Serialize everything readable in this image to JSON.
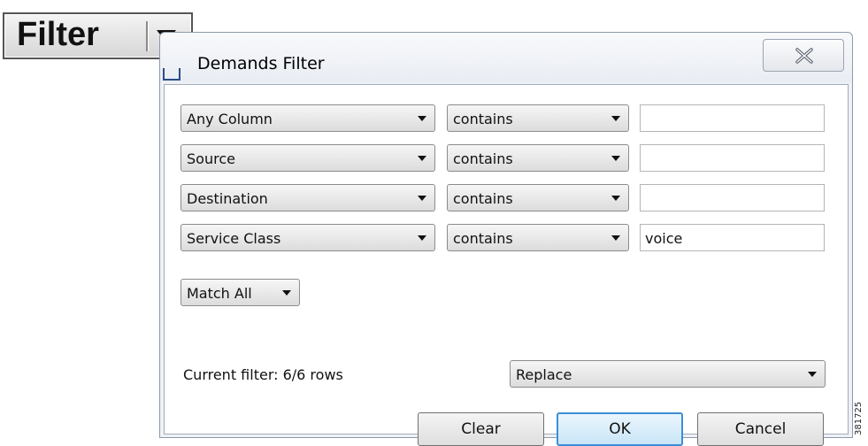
{
  "callout": {
    "label": "Filter",
    "icon": "dropdown-arrow-icon"
  },
  "dialog": {
    "title": "Demands  Filter",
    "icons": {
      "app": "app-window-icon",
      "close": "close-icon"
    },
    "rows": [
      {
        "column": "Any Column",
        "operator": "contains",
        "value": ""
      },
      {
        "column": "Source",
        "operator": "contains",
        "value": ""
      },
      {
        "column": "Destination",
        "operator": "contains",
        "value": ""
      },
      {
        "column": "Service Class",
        "operator": "contains",
        "value": "voice"
      }
    ],
    "match_mode": "Match All",
    "status": "Current filter: 6/6 rows",
    "apply_mode": "Replace",
    "buttons": {
      "clear": "Clear",
      "ok": "OK",
      "cancel": "Cancel"
    }
  },
  "figure_id": "381725",
  "colors": {
    "ok_border": "#3c8fd6",
    "dialog_bg": "#eef1f6"
  }
}
